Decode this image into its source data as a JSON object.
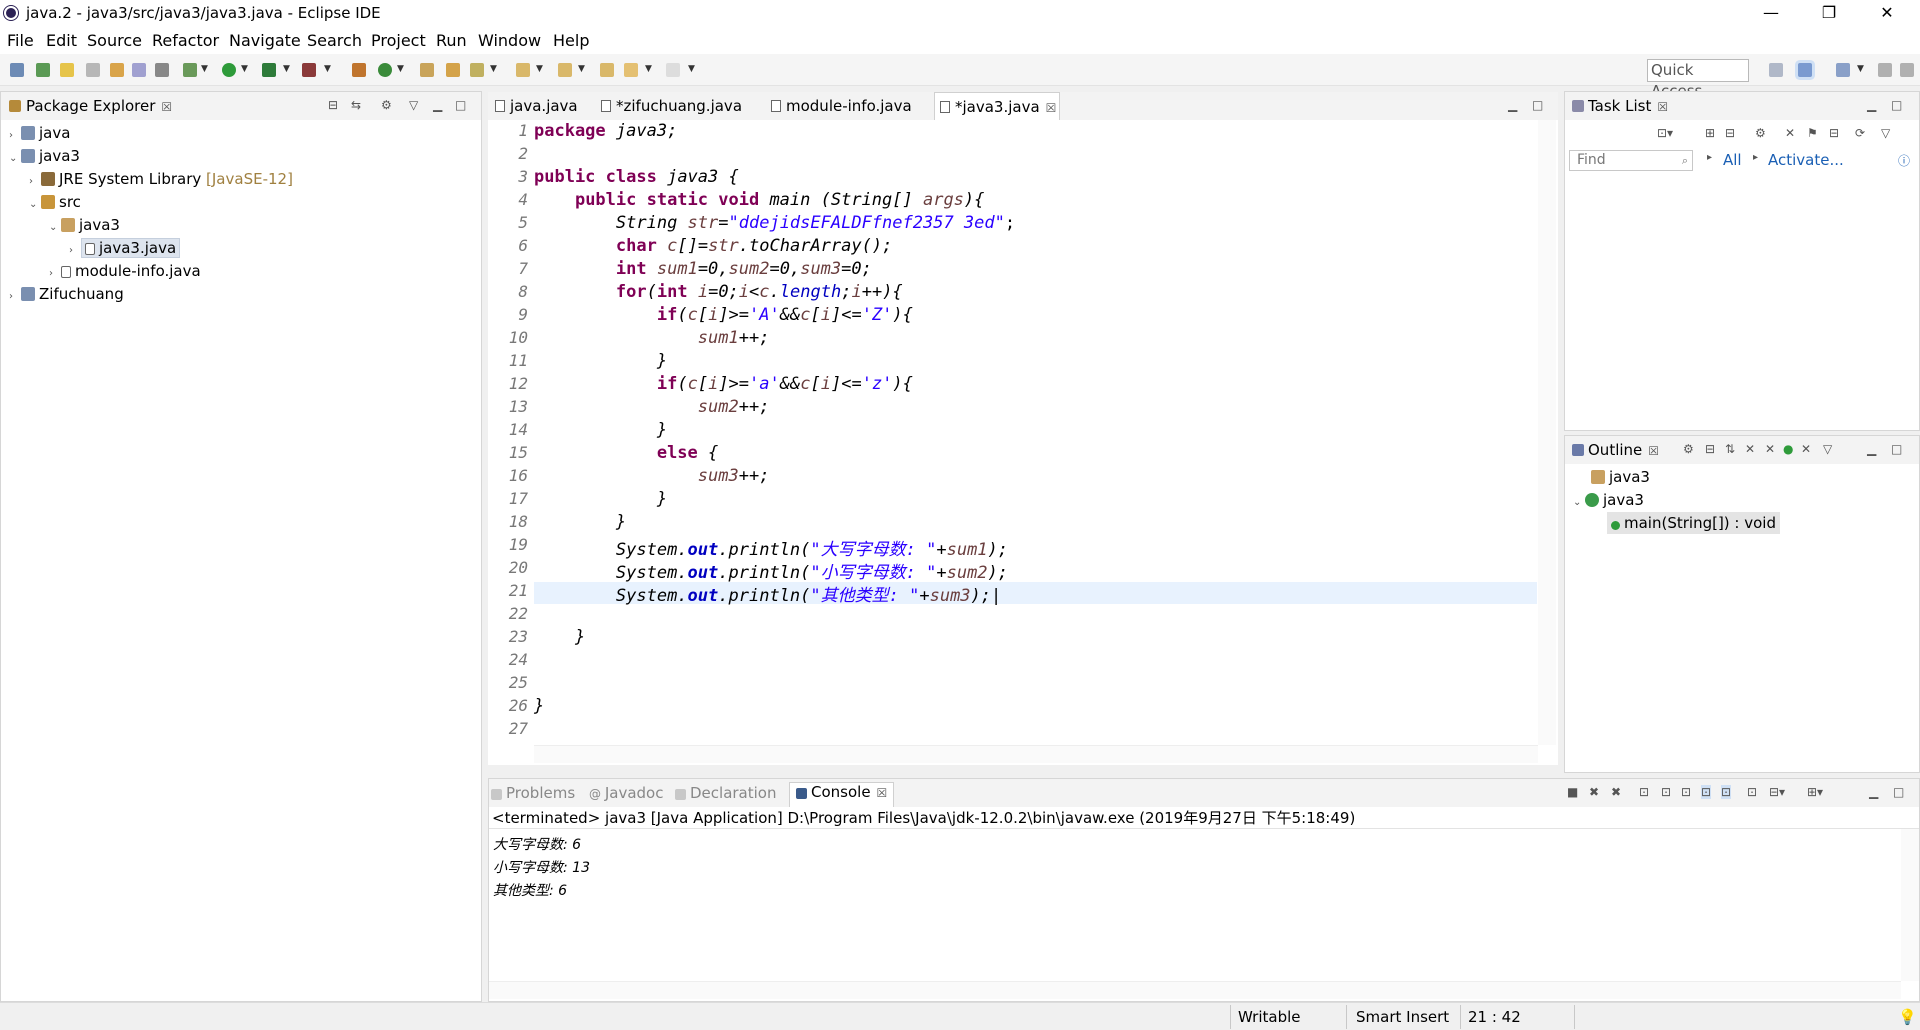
{
  "window": {
    "title": "java.2 - java3/src/java3/java3.java - Eclipse IDE",
    "minimize": "—",
    "restore": "❐",
    "close": "✕"
  },
  "menu": [
    "File",
    "Edit",
    "Source",
    "Refactor",
    "Navigate",
    "Search",
    "Project",
    "Run",
    "Window",
    "Help"
  ],
  "toolbar": {
    "quick_access_placeholder": "Quick Access"
  },
  "package_explorer": {
    "title": "Package Explorer",
    "items": [
      {
        "label": "java",
        "suffix": ""
      },
      {
        "label": "java3",
        "suffix": ""
      },
      {
        "label": "JRE System Library",
        "suffix": "[JavaSE-12]"
      },
      {
        "label": "src",
        "suffix": ""
      },
      {
        "label": "java3",
        "suffix": ""
      },
      {
        "label": "java3.java",
        "suffix": ""
      },
      {
        "label": "module-info.java",
        "suffix": ""
      },
      {
        "label": "Zifuchuang",
        "suffix": ""
      }
    ]
  },
  "editor": {
    "tabs": [
      "java.java",
      "*zifuchuang.java",
      "module-info.java",
      "*java3.java"
    ],
    "active_tab": "*java3.java",
    "line_numbers": [
      "1",
      "2",
      "3",
      "4",
      "5",
      "6",
      "7",
      "8",
      "9",
      "10",
      "11",
      "12",
      "13",
      "14",
      "15",
      "16",
      "17",
      "18",
      "19",
      "20",
      "21",
      "22",
      "23",
      "24",
      "25",
      "26",
      "27"
    ]
  },
  "task_list": {
    "title": "Task List",
    "find_placeholder": "Find",
    "all_label": "All",
    "activate_label": "Activate..."
  },
  "outline": {
    "title": "Outline",
    "items": [
      "java3",
      "java3",
      "main(String[]) : void"
    ]
  },
  "console": {
    "tabs": [
      "Problems",
      "Javadoc",
      "Declaration",
      "Console"
    ],
    "active_tab": "Console",
    "header": "<terminated> java3 [Java Application] D:\\Program Files\\Java\\jdk-12.0.2\\bin\\javaw.exe (2019年9月27日 下午5:18:49)",
    "output": [
      "大写字母数: 6",
      "小写字母数: 13",
      "其他类型: 6"
    ]
  },
  "status": {
    "writable": "Writable",
    "insert_mode": "Smart Insert",
    "position": "21 : 42"
  },
  "colors": {
    "keyword": "#7f0055",
    "string": "#2a00ff",
    "local_var": "#6a3e3e",
    "field": "#0000c0",
    "current_line": "#e8f2fe",
    "link": "#1a5fb4"
  }
}
